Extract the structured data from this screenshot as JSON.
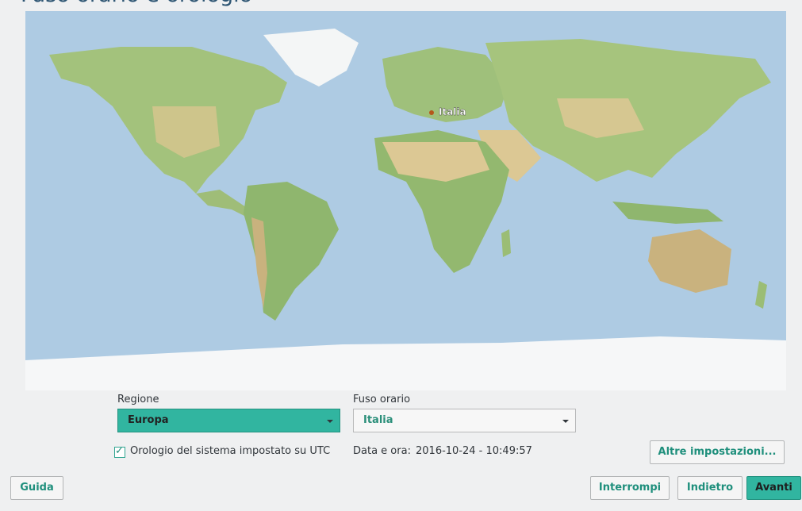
{
  "page": {
    "title": "Fuso orario e orologio"
  },
  "map": {
    "marker_label": "Italia",
    "marker_color": "#b5581b"
  },
  "region": {
    "label": "Regione",
    "value": "Europa"
  },
  "timezone": {
    "label": "Fuso orario",
    "value": "Italia"
  },
  "utc_checkbox": {
    "label": "Orologio del sistema impostato su UTC",
    "checked": true
  },
  "datetime": {
    "label": "Data e ora:",
    "value": "2016-10-24 - 10:49:57"
  },
  "buttons": {
    "other_settings": "Altre impostazioni...",
    "help": "Guida",
    "abort": "Interrompi",
    "back": "Indietro",
    "next": "Avanti"
  },
  "colors": {
    "accent": "#31b5a0",
    "ocean": "#b3cfe6",
    "land": "#9bbf78",
    "desert": "#d9c892"
  }
}
